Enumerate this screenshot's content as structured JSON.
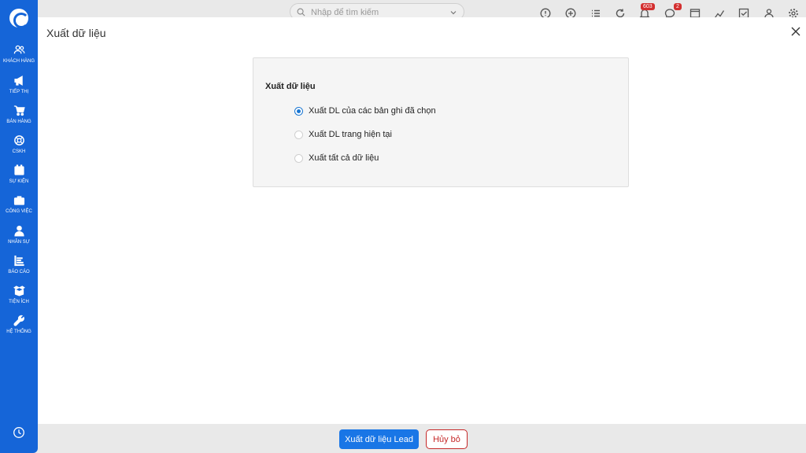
{
  "sidebar": {
    "items": [
      {
        "label": "KHÁCH HÀNG",
        "icon": "users-icon"
      },
      {
        "label": "TIẾP THỊ",
        "icon": "megaphone-icon"
      },
      {
        "label": "BÁN HÀNG",
        "icon": "cart-icon"
      },
      {
        "label": "CSKH",
        "icon": "lifebuoy-icon"
      },
      {
        "label": "SỰ KIỆN",
        "icon": "calendar-icon"
      },
      {
        "label": "CÔNG VIỆC",
        "icon": "briefcase-icon"
      },
      {
        "label": "NHÂN SỰ",
        "icon": "person-icon"
      },
      {
        "label": "BÁO CÁO",
        "icon": "report-icon"
      },
      {
        "label": "TIỆN ÍCH",
        "icon": "box-icon"
      },
      {
        "label": "HỆ THỐNG",
        "icon": "wrench-icon"
      }
    ]
  },
  "topbar": {
    "search_placeholder": "Nhập để tìm kiếm",
    "notification_badge": "603",
    "chat_badge": "2"
  },
  "modal": {
    "title": "Xuất dữ liệu",
    "section_label": "Xuất dữ liệu",
    "options": [
      {
        "label": "Xuất DL của các bản ghi đã chọn",
        "checked": true
      },
      {
        "label": "Xuất DL trang hiện tại",
        "checked": false
      },
      {
        "label": "Xuất tất cả dữ liệu",
        "checked": false
      }
    ],
    "primary_button": "Xuất dữ liệu Lead",
    "cancel_button": "Hủy bỏ"
  },
  "colors": {
    "sidebar": "#1565d8",
    "primary": "#1976e6",
    "cancel": "#c62828"
  }
}
